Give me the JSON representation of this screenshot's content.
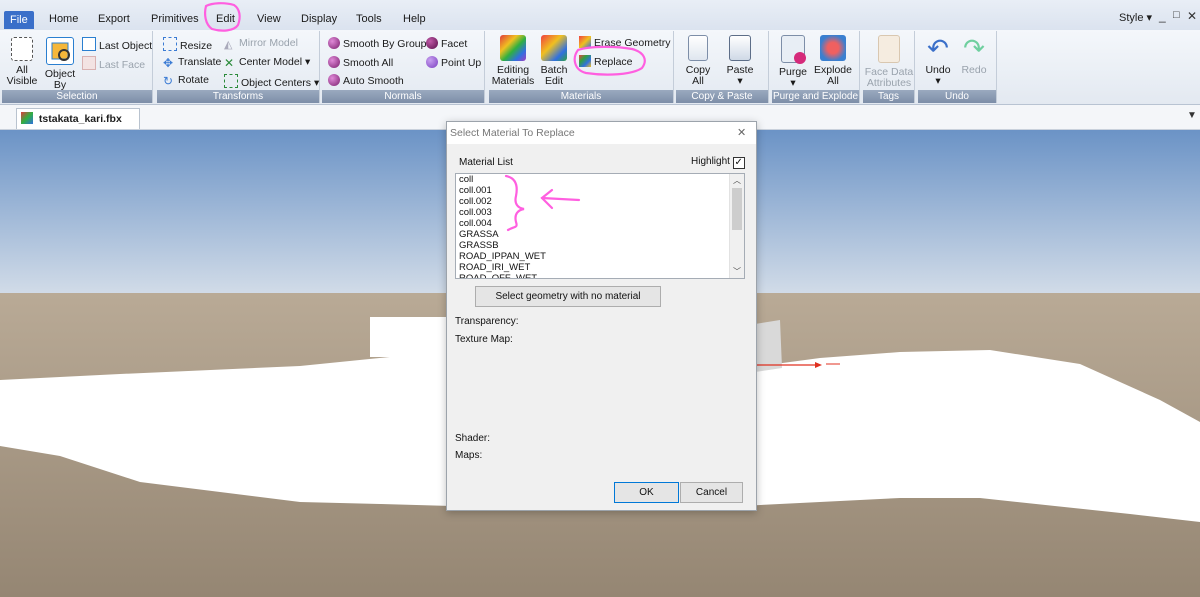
{
  "menubar": {
    "items": [
      "File",
      "Home",
      "Export",
      "Primitives",
      "Edit",
      "View",
      "Display",
      "Tools",
      "Help"
    ],
    "style_label": "Style",
    "window_controls": [
      "_",
      "□",
      "✕"
    ]
  },
  "ribbon": {
    "selection": {
      "label": "Selection",
      "all_visible": [
        "All",
        "Visible"
      ],
      "object_by_name": [
        "Object",
        "By Name"
      ],
      "last_object": "Last Object",
      "last_face": "Last Face"
    },
    "transforms": {
      "label": "Transforms",
      "resize": "Resize",
      "translate": "Translate",
      "rotate": "Rotate",
      "mirror_model": "Mirror Model",
      "center_model": "Center Model",
      "object_centers": "Object Centers"
    },
    "normals": {
      "label": "Normals",
      "smooth_by_group": "Smooth By Group",
      "smooth_all": "Smooth All",
      "auto_smooth": "Auto Smooth",
      "facet": "Facet",
      "point_up": "Point Up"
    },
    "materials": {
      "label": "Materials",
      "editing_materials": [
        "Editing",
        "Materials"
      ],
      "batch_edit": [
        "Batch",
        "Edit"
      ],
      "erase_geometry": "Erase Geometry",
      "replace": "Replace"
    },
    "copy_paste": {
      "label": "Copy & Paste",
      "copy_all": [
        "Copy",
        "All"
      ],
      "paste": "Paste"
    },
    "purge_explode": {
      "label": "Purge and Explode",
      "purge": "Purge",
      "explode_all": [
        "Explode",
        "All"
      ]
    },
    "tags": {
      "label": "Tags",
      "face_data_attributes": [
        "Face Data",
        "Attributes"
      ]
    },
    "undo_group": {
      "label": "Undo",
      "undo": "Undo",
      "redo": "Redo"
    }
  },
  "tabs": {
    "document": "tstakata_kari.fbx",
    "close": "✕"
  },
  "dialog": {
    "title": "Select Material To Replace",
    "close": "✕",
    "material_list_label": "Material List",
    "highlight_label": "Highlight",
    "highlight_checked": true,
    "materials": [
      "coll",
      "coll.001",
      "coll.002",
      "coll.003",
      "coll.004",
      "GRASSA",
      "GRASSB",
      "ROAD_IPPAN_WET",
      "ROAD_IRI_WET",
      "ROAD_OFF_WET"
    ],
    "select_no_material_button": "Select geometry with no material",
    "transparency_label": "Transparency:",
    "texture_map_label": "Texture Map:",
    "shader_label": "Shader:",
    "maps_label": "Maps:",
    "ok": "OK",
    "cancel": "Cancel"
  },
  "colors": {
    "sky_top": "#6b93c6",
    "sky_bottom": "#d2dce8",
    "ground": "#958673",
    "annotation": "#ff5fe0",
    "menu_active": "#3a6fc9",
    "axis_red": "#e03020"
  }
}
